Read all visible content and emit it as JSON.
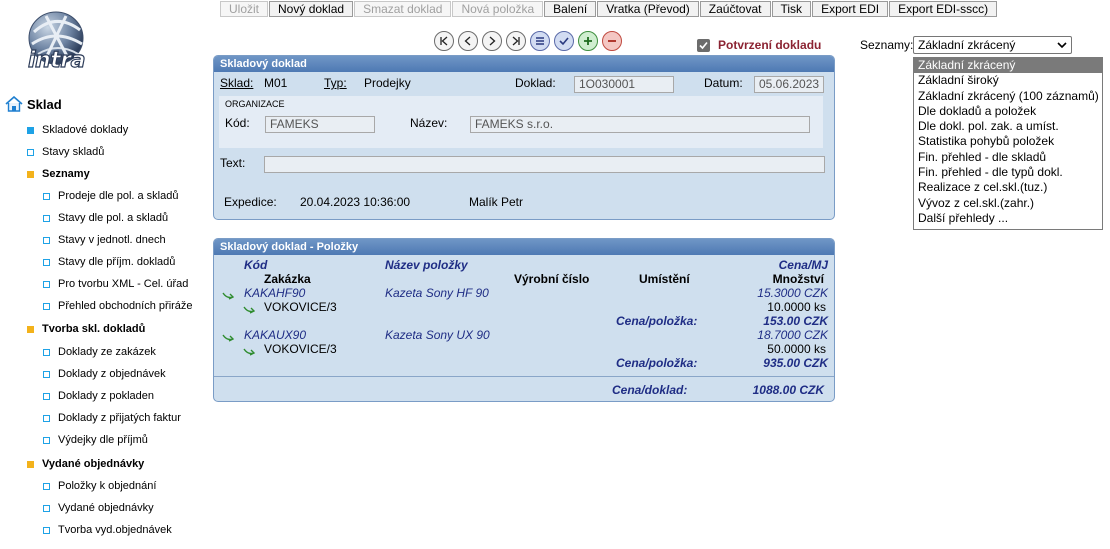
{
  "toolbar": {
    "buttons": [
      {
        "label": "Uložit",
        "enabled": false
      },
      {
        "label": "Nový doklad",
        "enabled": true
      },
      {
        "label": "Smazat doklad",
        "enabled": false
      },
      {
        "label": "Nová položka",
        "enabled": false
      },
      {
        "label": "Balení",
        "enabled": true
      },
      {
        "label": "Vratka (Převod)",
        "enabled": true
      },
      {
        "label": "Zaúčtovat",
        "enabled": true
      },
      {
        "label": "Tisk",
        "enabled": true
      },
      {
        "label": "Export EDI",
        "enabled": true
      },
      {
        "label": "Export EDI-sscc)",
        "enabled": true
      }
    ]
  },
  "nav_icons": [
    "first-icon",
    "prev-icon",
    "next-icon",
    "last-icon",
    "list-icon",
    "check-icon",
    "add-icon",
    "remove-icon"
  ],
  "logo": {
    "text": "intra"
  },
  "confirm": {
    "label": "Potvrzení dokladu",
    "checked": true
  },
  "seznamy": {
    "label": "Seznamy:",
    "selected": "Základní zkrácený",
    "options": [
      "Základní zkrácený",
      "Základní široký",
      "Základní zkrácený (100 záznamů)",
      "Dle dokladů a položek",
      "Dle dokl. pol. zak. a umíst.",
      "Statistika pohybů položek",
      "Fin. přehled - dle skladů",
      "Fin. přehled - dle typů dokl.",
      "Realizace z cel.skl.(tuz.)",
      "Vývoz z cel.skl.(zahr.)",
      "Další přehledy ..."
    ]
  },
  "sidebar": {
    "root": "Sklad",
    "items": [
      {
        "label": "Skladové doklady",
        "kind": "filled",
        "level": 1
      },
      {
        "label": "Stavy skladů",
        "kind": "hollow",
        "level": 1
      },
      {
        "label": "Seznamy",
        "kind": "folder",
        "level": 1
      },
      {
        "label": "Prodeje dle pol. a skladů",
        "kind": "hollow",
        "level": 2
      },
      {
        "label": "Stavy dle pol. a skladů",
        "kind": "hollow",
        "level": 2
      },
      {
        "label": "Stavy v jednotl. dnech",
        "kind": "hollow",
        "level": 2
      },
      {
        "label": "Stavy dle příjm. dokladů",
        "kind": "hollow",
        "level": 2
      },
      {
        "label": "Pro tvorbu XML - Cel. úřad",
        "kind": "hollow",
        "level": 2
      },
      {
        "label": "Přehled obchodních přiráže",
        "kind": "hollow",
        "level": 2
      },
      {
        "label": "Tvorba skl. dokladů",
        "kind": "folder",
        "level": 1
      },
      {
        "label": "Doklady ze zakázek",
        "kind": "hollow",
        "level": 2
      },
      {
        "label": "Doklady z objednávek",
        "kind": "hollow",
        "level": 2
      },
      {
        "label": "Doklady z pokladen",
        "kind": "hollow",
        "level": 2
      },
      {
        "label": "Doklady z přijatých faktur",
        "kind": "hollow",
        "level": 2
      },
      {
        "label": "Výdejky dle příjmů",
        "kind": "hollow",
        "level": 2
      },
      {
        "label": "Vydané objednávky",
        "kind": "folder",
        "level": 1
      },
      {
        "label": "Položky k objednání",
        "kind": "hollow",
        "level": 2
      },
      {
        "label": "Vydané objednávky",
        "kind": "hollow",
        "level": 2
      },
      {
        "label": "Tvorba vyd.objednávek",
        "kind": "hollow",
        "level": 2
      }
    ]
  },
  "doc": {
    "title": "Skladový doklad",
    "sklad_label": "Sklad:",
    "sklad_value": "M01",
    "typ_label": "Typ:",
    "typ_value": "Prodejky",
    "doklad_label": "Doklad:",
    "doklad_value": "1O030001",
    "datum_label": "Datum:",
    "datum_value": "05.06.2023",
    "org_title": "ORGANIZACE",
    "kod_label": "Kód:",
    "kod_value": "FAMEKS",
    "nazev_label": "Název:",
    "nazev_value": "FAMEKS s.r.o.",
    "text_label": "Text:",
    "text_value": "",
    "expedice_label": "Expedice:",
    "expedice_date": "20.04.2023 10:36:00",
    "expedice_person": "Malík Petr"
  },
  "items_panel": {
    "title": "Skladový doklad - Položky",
    "headers": {
      "kod": "Kód",
      "zakazka": "Zakázka",
      "nazev": "Název položky",
      "vyrobni": "Výrobní číslo",
      "umisteni": "Umístění",
      "cena_mj": "Cena/MJ",
      "mnozstvi": "Množství"
    },
    "rows": [
      {
        "kod": "KAKAHF90",
        "zakazka": "VOKOVICE/3",
        "nazev": "Kazeta Sony HF 90",
        "cena_mj": "15.3000 CZK",
        "mnozstvi": "10.0000 ks",
        "cena_pol_label": "Cena/položka:",
        "cena_pol": "153.00 CZK"
      },
      {
        "kod": "KAKAUX90",
        "zakazka": "VOKOVICE/3",
        "nazev": "Kazeta Sony UX 90",
        "cena_mj": "18.7000 CZK",
        "mnozstvi": "50.0000 ks",
        "cena_pol_label": "Cena/položka:",
        "cena_pol": "935.00 CZK"
      }
    ],
    "total_label": "Cena/doklad:",
    "total_value": "1088.00 CZK"
  }
}
